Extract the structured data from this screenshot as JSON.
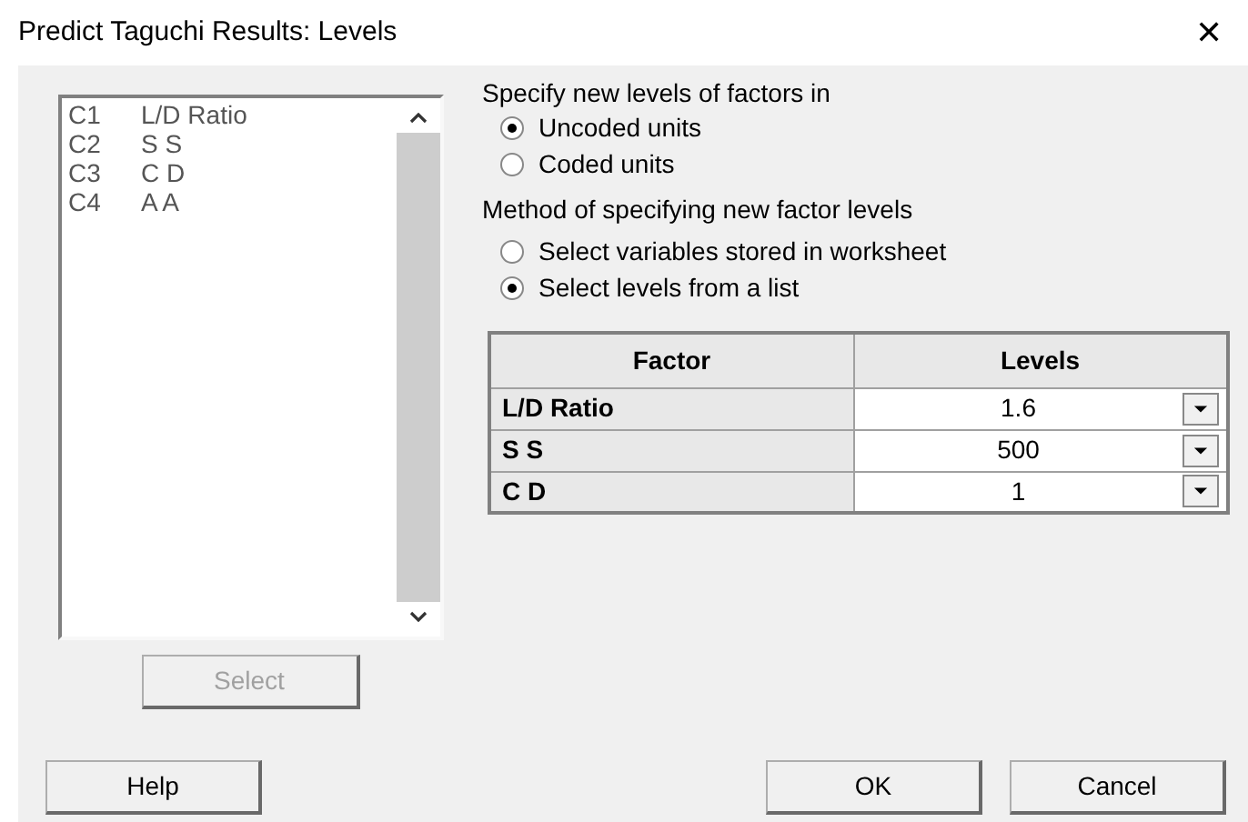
{
  "window": {
    "title": "Predict Taguchi Results: Levels",
    "close": "✕"
  },
  "variables": [
    {
      "column": "C1",
      "name": "L/D Ratio"
    },
    {
      "column": "C2",
      "name": "S S"
    },
    {
      "column": "C3",
      "name": "C D"
    },
    {
      "column": "C4",
      "name": "A A"
    }
  ],
  "select_button": {
    "label": "Select",
    "disabled": true
  },
  "units": {
    "label": "Specify new levels of factors in",
    "options": [
      {
        "label": "Uncoded units",
        "selected": true
      },
      {
        "label": "Coded units",
        "selected": false
      }
    ]
  },
  "method": {
    "label": "Method of specifying new factor levels",
    "options": [
      {
        "label": "Select variables stored in worksheet",
        "selected": false
      },
      {
        "label": "Select levels from a list",
        "selected": true
      }
    ]
  },
  "table": {
    "columns": [
      "Factor",
      "Levels"
    ],
    "rows": [
      {
        "factor": "L/D Ratio",
        "level": "1.6"
      },
      {
        "factor": "S S",
        "level": "500"
      },
      {
        "factor": "C D",
        "level": "1"
      }
    ]
  },
  "buttons": [
    {
      "label": "Help",
      "kind": "help"
    },
    {
      "label": "OK",
      "kind": "ok"
    },
    {
      "label": "Cancel",
      "kind": "cancel"
    }
  ]
}
